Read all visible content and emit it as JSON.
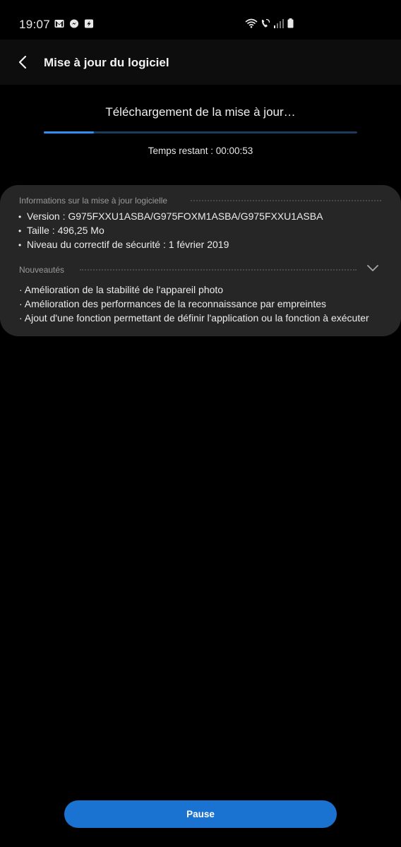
{
  "status_bar": {
    "time": "19:07",
    "left_icons": [
      "gmail-icon",
      "messenger-icon",
      "sync-app-icon"
    ],
    "right_icons": [
      "wifi-icon",
      "wifi-calling-icon",
      "cell-signal-icon",
      "battery-icon"
    ]
  },
  "app_bar": {
    "title": "Mise à jour du logiciel",
    "back_icon": "back-arrow-icon"
  },
  "download": {
    "title": "Téléchargement de la mise à jour…",
    "progress_fraction": 0.16,
    "time_left": "Temps restant : 00:00:53",
    "colors": {
      "progress_fill": "#2f8ff0",
      "progress_track": "#1b3a5c"
    }
  },
  "info": {
    "section_title": "Informations sur la mise à jour logicielle",
    "items": [
      "Version : G975FXXU1ASBA/G975FOXM1ASBA/G975FXXU1ASBA",
      "Taille : 496,25 Mo",
      "Niveau du correctif de sécurité : 1 février 2019"
    ],
    "news_title": "Nouveautés",
    "news_items": [
      "· Amélioration de la stabilité de l'appareil photo",
      "· Amélioration des performances de la reconnaissance par empreintes",
      "· Ajout d'une fonction permettant de définir l'application ou la fonction à exécuter"
    ]
  },
  "pause_button": {
    "label": "Pause",
    "color": "#1a73d0"
  }
}
